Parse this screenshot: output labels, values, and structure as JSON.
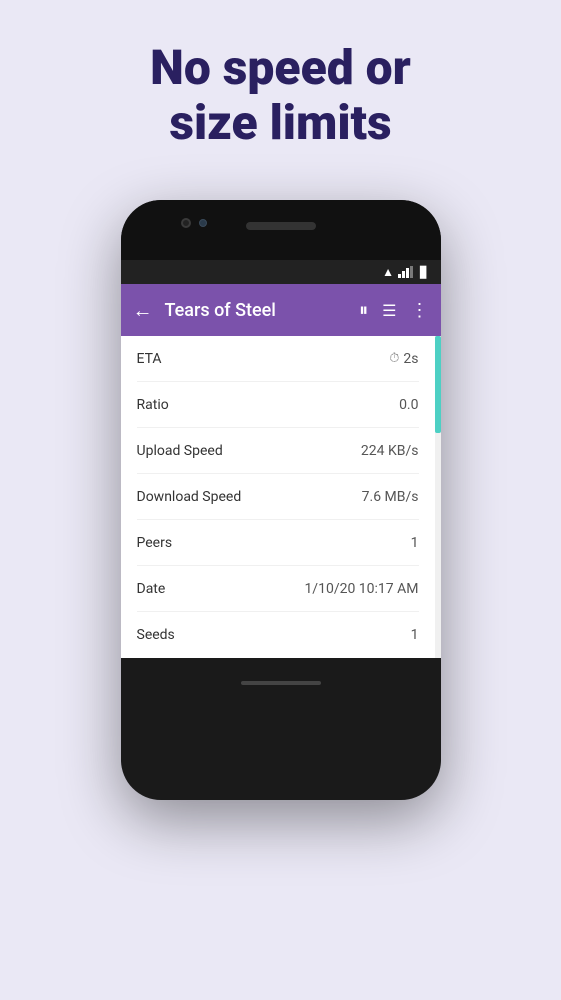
{
  "headline": {
    "line1": "No speed or",
    "line2": "size limits"
  },
  "colors": {
    "background": "#eae8f5",
    "headline": "#2a2060",
    "appbar": "#7b52ab",
    "progress": "#4dd0c4"
  },
  "appbar": {
    "title": "Tears of Steel",
    "back_icon": "←",
    "pause_icon": "⏸",
    "list_icon": "☰",
    "more_icon": "⋮"
  },
  "rows": [
    {
      "label": "ETA",
      "value": "2s",
      "has_clock": true
    },
    {
      "label": "Ratio",
      "value": "0.0",
      "has_clock": false
    },
    {
      "label": "Upload Speed",
      "value": "224 KB/s",
      "has_clock": false
    },
    {
      "label": "Download Speed",
      "value": "7.6 MB/s",
      "has_clock": false
    },
    {
      "label": "Peers",
      "value": "1",
      "has_clock": false
    },
    {
      "label": "Date",
      "value": "1/10/20 10:17 AM",
      "has_clock": false
    },
    {
      "label": "Seeds",
      "value": "1",
      "has_clock": false
    }
  ]
}
